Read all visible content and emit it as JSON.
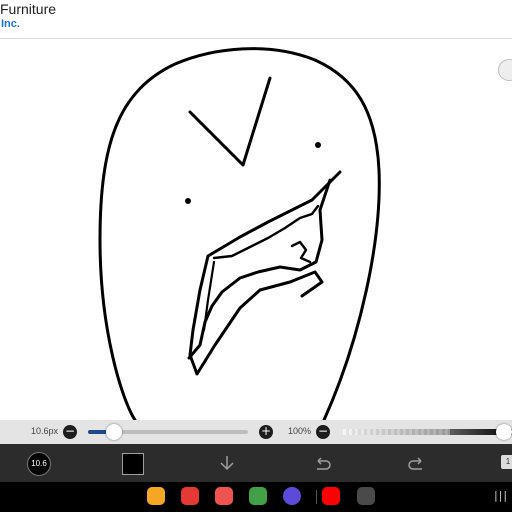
{
  "ad": {
    "title": "Furniture",
    "subtitle": "Inc."
  },
  "brush": {
    "size_label": "10.6px",
    "size_fraction": 0.16,
    "opacity_label": "100%",
    "opacity_fraction": 1.0,
    "minus_icon": "−",
    "plus_icon": "+",
    "preview_label": "10.6"
  },
  "toolbar": {
    "current_color": "#000000",
    "icons": {
      "download": "download-arrow-icon",
      "undo": "undo-icon",
      "redo": "redo-icon",
      "layers": "layers-icon"
    },
    "layers_badge": "1"
  },
  "colors": {
    "slider_fill": "#1e4a8a",
    "toolbar_bg": "#2c2c2c",
    "ad_link": "#1a73e8"
  },
  "dock": {
    "apps": [
      {
        "name": "files-app-icon",
        "color": "#f5a623"
      },
      {
        "name": "flipboard-app-icon",
        "color": "#e53935"
      },
      {
        "name": "contacts-app-icon",
        "color": "#ef5350"
      },
      {
        "name": "calculator-app-icon",
        "color": "#43a047"
      },
      {
        "name": "samsung-internet-app-icon",
        "color": "#5c4bdb"
      },
      {
        "name": "youtube-app-icon",
        "color": "#ff0000"
      },
      {
        "name": "roblox-app-icon",
        "color": "#4a4a4a"
      }
    ]
  }
}
